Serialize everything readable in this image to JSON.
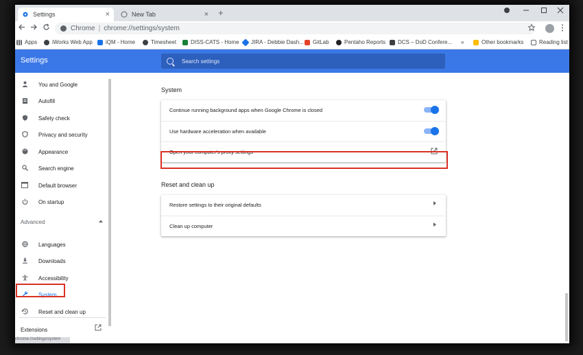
{
  "tabs": [
    {
      "label": "Settings",
      "close": "×"
    },
    {
      "label": "New Tab",
      "close": "×"
    }
  ],
  "new_tab": "+",
  "omnibox": {
    "site": "Chrome",
    "separator": "|",
    "url": "chrome://settings/system"
  },
  "bookmarks": [
    {
      "label": "Apps",
      "icon": "apps-grid-icon",
      "color": "#5f6368"
    },
    {
      "label": "iWorks Web App",
      "icon": "globe-icon",
      "color": "#3c4043"
    },
    {
      "label": "iQM - Home",
      "icon": "iqm-icon",
      "color": "#1a73e8"
    },
    {
      "label": "Timesheet",
      "icon": "timesheet-icon",
      "color": "#3c4043"
    },
    {
      "label": "DISS-CATS - Home",
      "icon": "diss-icon",
      "color": "#188038"
    },
    {
      "label": "JIRA - Debbie Dash...",
      "icon": "jira-icon",
      "color": "#1a73e8"
    },
    {
      "label": "GitLab",
      "icon": "gitlab-icon",
      "color": "#e24329"
    },
    {
      "label": "Pentaho Reports",
      "icon": "pentaho-icon",
      "color": "#202124"
    },
    {
      "label": "DCS – DoD Confere...",
      "icon": "dcs-icon",
      "color": "#3c4043"
    },
    {
      "label": "»",
      "icon": "",
      "color": ""
    },
    {
      "label": "Other bookmarks",
      "icon": "folder-icon",
      "color": "#fbbc04"
    },
    {
      "label": "Reading list",
      "icon": "reading-list-icon",
      "color": "#5f6368"
    }
  ],
  "header": {
    "title": "Settings",
    "search_placeholder": "Search settings",
    "accent": "#3b78e7"
  },
  "sidebar": {
    "items": [
      {
        "label": "You and Google",
        "icon": "person-icon"
      },
      {
        "label": "Autofill",
        "icon": "clipboard-icon"
      },
      {
        "label": "Safety check",
        "icon": "shield-check-icon"
      },
      {
        "label": "Privacy and security",
        "icon": "shield-icon"
      },
      {
        "label": "Appearance",
        "icon": "palette-icon"
      },
      {
        "label": "Search engine",
        "icon": "search-icon"
      },
      {
        "label": "Default browser",
        "icon": "browser-icon"
      },
      {
        "label": "On startup",
        "icon": "power-icon"
      }
    ],
    "advanced_label": "Advanced",
    "advanced_items": [
      {
        "label": "Languages",
        "icon": "globe-icon"
      },
      {
        "label": "Downloads",
        "icon": "download-icon"
      },
      {
        "label": "Accessibility",
        "icon": "accessibility-icon"
      },
      {
        "label": "System",
        "icon": "wrench-icon"
      },
      {
        "label": "Reset and clean up",
        "icon": "history-icon"
      }
    ],
    "extensions_label": "Extensions",
    "status_url": "chrome://settings/system"
  },
  "main": {
    "system_title": "System",
    "system_rows": [
      {
        "label": "Continue running background apps when Google Chrome is closed",
        "toggle": true
      },
      {
        "label": "Use hardware acceleration when available",
        "toggle": true
      },
      {
        "label": "Open your computer's proxy settings",
        "toggle": false
      }
    ],
    "reset_title": "Reset and clean up",
    "reset_rows": [
      {
        "label": "Restore settings to their original defaults"
      },
      {
        "label": "Clean up computer"
      }
    ]
  }
}
